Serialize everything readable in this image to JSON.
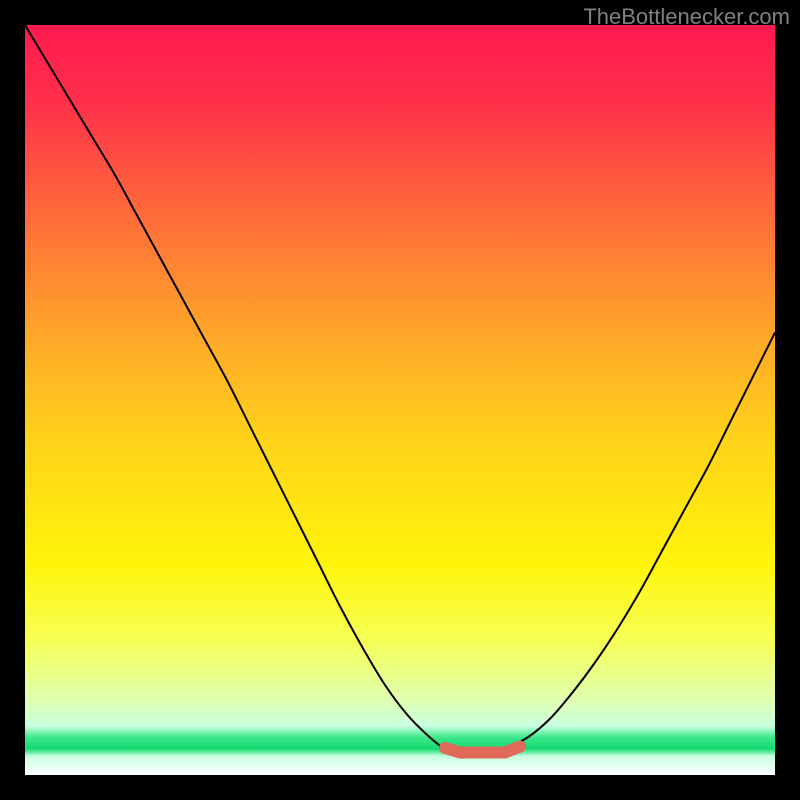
{
  "watermark": "TheBottlenecker.com",
  "chart_data": {
    "type": "line",
    "title": "",
    "xlabel": "",
    "ylabel": "",
    "xlim": [
      0,
      100
    ],
    "ylim": [
      0,
      100
    ],
    "grid": false,
    "legend": false,
    "background_gradient": {
      "description": "Vertical gradient with horizontal green band near bottom",
      "stops": [
        {
          "offset": 0,
          "color": "#ff1a50"
        },
        {
          "offset": 0.1,
          "color": "#ff2f4a"
        },
        {
          "offset": 0.25,
          "color": "#ff6a3a"
        },
        {
          "offset": 0.4,
          "color": "#ffa22b"
        },
        {
          "offset": 0.55,
          "color": "#ffd21a"
        },
        {
          "offset": 0.72,
          "color": "#fff50a"
        },
        {
          "offset": 0.82,
          "color": "#f6ff55"
        },
        {
          "offset": 0.9,
          "color": "#dfffb0"
        },
        {
          "offset": 0.935,
          "color": "#c8ffe0"
        },
        {
          "offset": 0.95,
          "color": "#3be88a"
        },
        {
          "offset": 0.965,
          "color": "#14d96e"
        },
        {
          "offset": 0.975,
          "color": "#c8ffe0"
        },
        {
          "offset": 1.0,
          "color": "#ffffff"
        }
      ]
    },
    "series": [
      {
        "name": "bottleneck-curve",
        "color": "#000000",
        "stroke_width": 2,
        "x": [
          0,
          3,
          6,
          9,
          12,
          15,
          18,
          21,
          24,
          27,
          30,
          33,
          36,
          39,
          42,
          45,
          48,
          51,
          54,
          56,
          58,
          60,
          62,
          64,
          67,
          70,
          73,
          76,
          79,
          82,
          85,
          88,
          91,
          94,
          97,
          100
        ],
        "y": [
          100,
          95,
          90,
          85,
          80,
          74.5,
          69,
          63.5,
          58,
          52.5,
          46.5,
          40.5,
          34.5,
          28.5,
          22.5,
          17,
          12,
          8,
          5,
          3.5,
          3,
          3,
          3,
          3.5,
          5,
          7.5,
          11,
          15,
          19.5,
          24.5,
          30,
          35.5,
          41,
          47,
          53,
          59
        ]
      },
      {
        "name": "marker-band",
        "type": "marker",
        "color": "#e06a5a",
        "x": [
          56,
          58,
          60,
          62,
          64,
          66
        ],
        "y": [
          3.6,
          3.0,
          3.0,
          3.0,
          3.0,
          3.8
        ],
        "radius": 6
      }
    ]
  }
}
